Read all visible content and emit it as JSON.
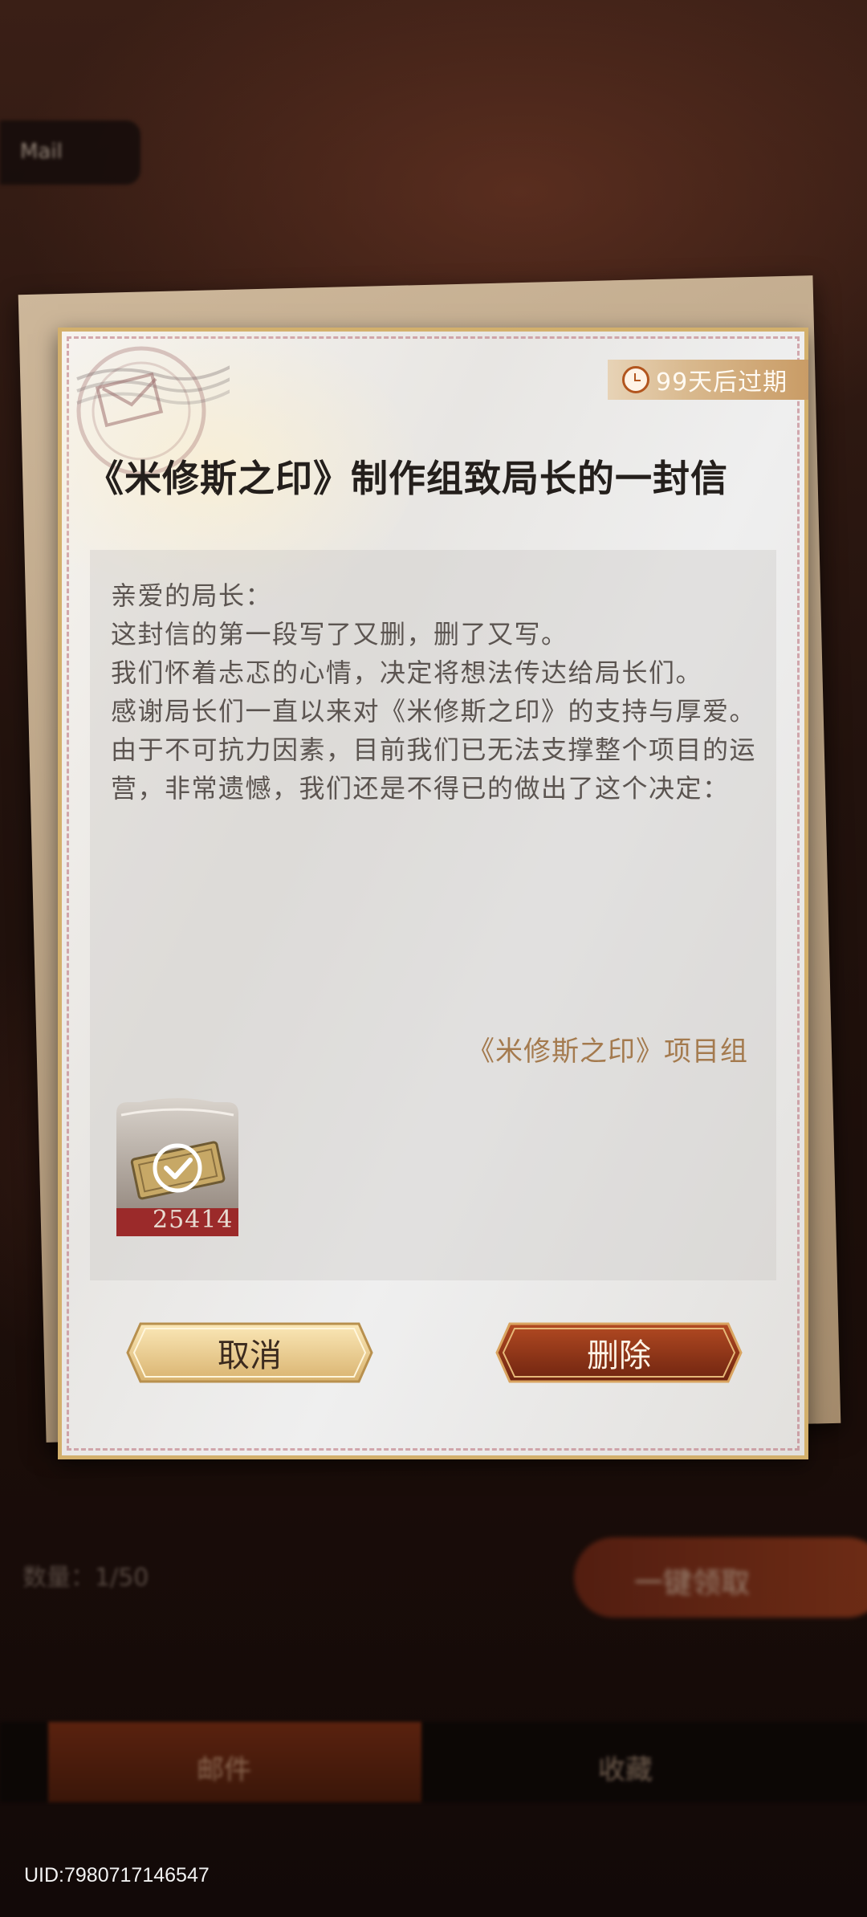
{
  "background": {
    "top_tab_label": "Mail",
    "count_label": "数量：1/50",
    "action_pill_label": "一键领取",
    "tabbar": [
      "邮件",
      "收藏"
    ]
  },
  "letter": {
    "expiry": "99天后过期",
    "title": "《米修斯之印》制作组致局长的一封信",
    "greeting": "亲爱的局长：",
    "paragraphs": [
      "这封信的第一段写了又删，删了又写。",
      "我们怀着忐忑的心情，决定将想法传达给局长们。",
      "感谢局长们一直以来对《米修斯之印》的支持与厚爱。",
      "由于不可抗力因素，目前我们已无法支撑整个项目的运营，非常遗憾，我们还是不得已的做出了这个决定："
    ],
    "signature": "《米修斯之印》项目组",
    "attachment": {
      "icon": "banknote-icon",
      "claimed": true,
      "count": "25414"
    }
  },
  "buttons": {
    "cancel": "取消",
    "delete": "删除"
  },
  "uid": "UID:7980717146547",
  "colors": {
    "accent_gold": "#d3b06c",
    "delete_button": "#8b3414",
    "signature": "#a47a4e"
  }
}
